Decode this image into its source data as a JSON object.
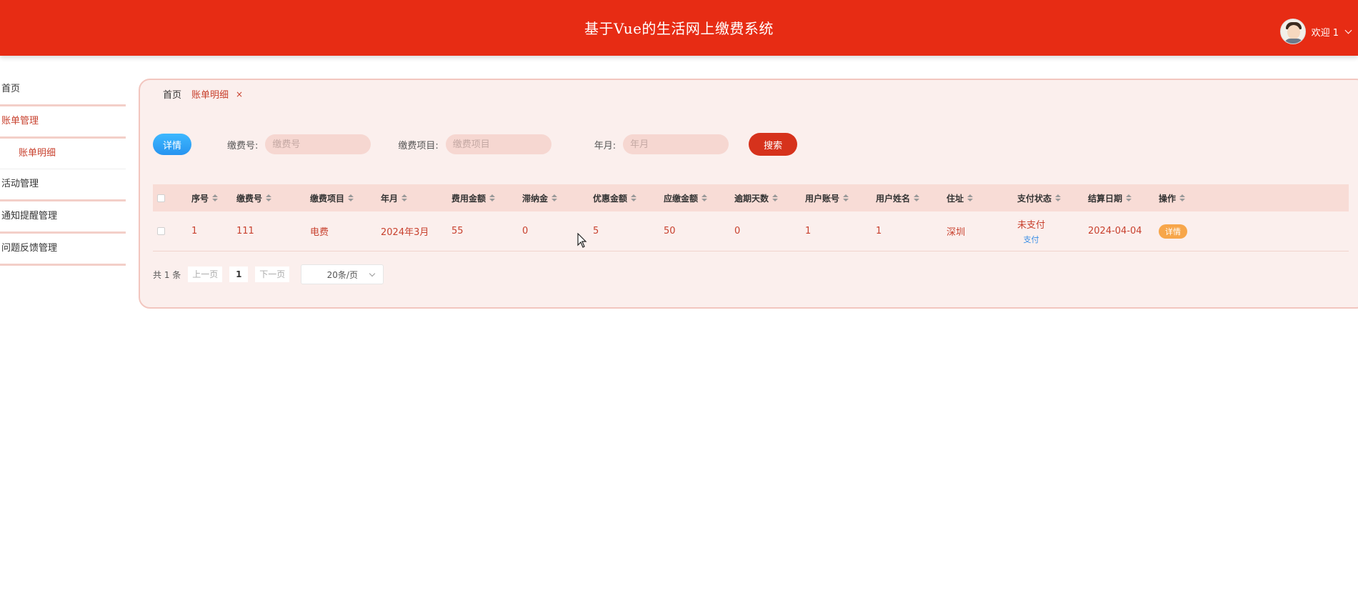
{
  "header": {
    "title": "基于Vue的生活网上缴费系统",
    "welcome": "欢迎 1"
  },
  "sidebar": {
    "items": [
      {
        "label": "首页"
      },
      {
        "label": "账单管理"
      },
      {
        "label": "账单明细"
      },
      {
        "label": "活动管理"
      },
      {
        "label": "通知提醒管理"
      },
      {
        "label": "问题反馈管理"
      }
    ]
  },
  "breadcrumb": {
    "home": "首页",
    "current": "账单明细",
    "close": "×"
  },
  "toolbar": {
    "detail_button": "详情",
    "fields": [
      {
        "label": "缴费号:",
        "placeholder": "缴费号"
      },
      {
        "label": "缴费项目:",
        "placeholder": "缴费项目"
      },
      {
        "label": "年月:",
        "placeholder": "年月"
      }
    ],
    "search_button": "搜索"
  },
  "table": {
    "columns": [
      "序号",
      "缴费号",
      "缴费项目",
      "年月",
      "费用金额",
      "滞纳金",
      "优惠金额",
      "应缴金额",
      "逾期天数",
      "用户账号",
      "用户姓名",
      "住址",
      "支付状态",
      "结算日期",
      "操作"
    ],
    "rows": [
      {
        "cells": [
          "1",
          "111",
          "电费",
          "2024年3月",
          "55",
          "0",
          "5",
          "50",
          "0",
          "1",
          "1",
          "深圳"
        ],
        "status": "未支付",
        "pay_action": "支付",
        "settle_date": "2024-04-04",
        "op_button": "详情"
      }
    ]
  },
  "pagination": {
    "total": "共 1 条",
    "prev": "上一页",
    "page": "1",
    "next": "下一页",
    "page_size": "20条/页"
  },
  "colors": {
    "header": "#e72c14",
    "accent": "#c8412e",
    "panel": "#fbefed",
    "detail_button": "#2794f0",
    "op_button": "#f7a64a"
  }
}
